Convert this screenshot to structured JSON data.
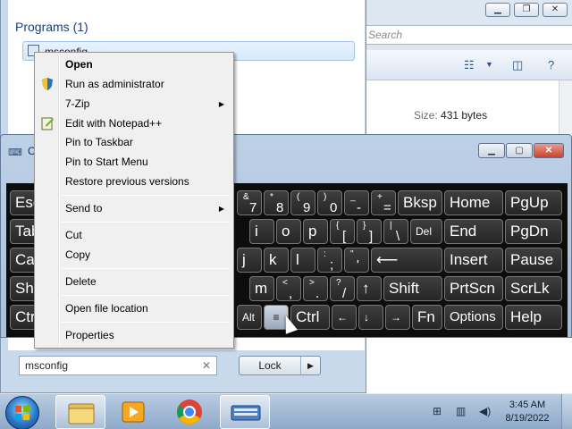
{
  "explorer": {
    "search_placeholder": "Search",
    "size_label": "Size:",
    "size_value": "431 bytes"
  },
  "start_menu": {
    "group_title": "Programs (1)",
    "result_item": "msconfig",
    "search_value": "msconfig",
    "clear_glyph": "✕",
    "lock_label": "Lock",
    "lock_arrow": "▶"
  },
  "osk": {
    "title": "O",
    "rows": [
      [
        "Esc",
        "&7",
        "*8",
        "(9",
        ")0",
        "_-",
        "+=",
        "Bksp",
        "Home",
        "PgUp"
      ],
      [
        "Tab",
        "i",
        "o",
        "p",
        "{[",
        "}]",
        "|\\",
        "Del",
        "End",
        "PgDn"
      ],
      [
        "Caps",
        "j",
        "k",
        "l",
        ":;",
        "\"'",
        "Enter",
        "Insert",
        "Pause"
      ],
      [
        "Shift",
        "m",
        "<,",
        ">.",
        "?/",
        "↑",
        "Shift",
        "PrtScn",
        "ScrLk"
      ],
      [
        "Ctrl",
        "Alt",
        "≡",
        "Ctrl",
        "←",
        "↓",
        "→",
        "Fn",
        "Options",
        "Help"
      ]
    ]
  },
  "context_menu": {
    "items": [
      {
        "label": "Open",
        "bold": true
      },
      {
        "label": "Run as administrator"
      },
      {
        "label": "7-Zip",
        "submenu": true
      },
      {
        "label": "Edit with Notepad++"
      },
      {
        "label": "Pin to Taskbar"
      },
      {
        "label": "Pin to Start Menu"
      },
      {
        "label": "Restore previous versions"
      },
      {
        "label": "Send to",
        "submenu": true
      },
      {
        "label": "Cut"
      },
      {
        "label": "Copy"
      },
      {
        "label": "Delete"
      },
      {
        "label": "Open file location"
      },
      {
        "label": "Properties"
      }
    ],
    "submenu_arrow": "▶"
  },
  "taskbar": {
    "time": "3:45 AM",
    "date": "8/19/2022",
    "apps": [
      "windows-explorer",
      "media-player",
      "chrome",
      "on-screen-keyboard"
    ]
  },
  "colors": {
    "accent": "#2a78c8",
    "osk_key_bg": "#262626",
    "osk_bg": "#0d0d0d",
    "close_red": "#c9432f"
  }
}
